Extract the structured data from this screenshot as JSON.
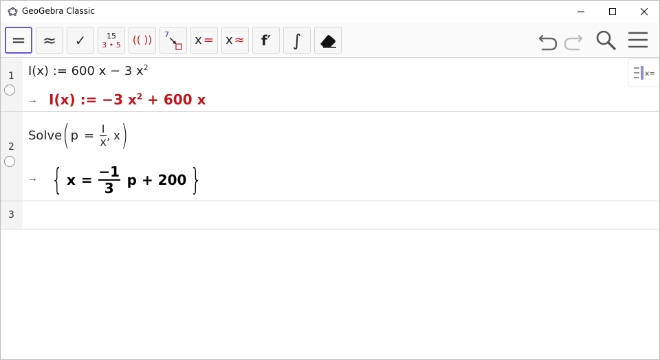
{
  "window": {
    "title": "GeoGebra Classic"
  },
  "toolbar": {
    "buttons": [
      {
        "name": "evaluate",
        "symbol": "="
      },
      {
        "name": "numeric",
        "symbol": "≈"
      },
      {
        "name": "check",
        "symbol": "✓"
      },
      {
        "name": "factor-number",
        "top": "15",
        "bottom": "3 • 5"
      },
      {
        "name": "expand",
        "symbol": "(( ))"
      },
      {
        "name": "substitute",
        "top": "7"
      },
      {
        "name": "solve",
        "symbol": "x",
        "sign": "="
      },
      {
        "name": "solve-numerically",
        "symbol": "x",
        "sign": "≈"
      },
      {
        "name": "derivative",
        "symbol": "f′"
      },
      {
        "name": "integral",
        "symbol": "∫"
      },
      {
        "name": "delete",
        "symbol": ""
      }
    ]
  },
  "algebra": {
    "rows": [
      {
        "number": "1",
        "input": {
          "lhs": "I(x) := 600 x − 3 x",
          "exp": "2"
        },
        "output": {
          "part1": "I(x) := −3 x",
          "exp": "2",
          "part2": " + 600 x"
        }
      },
      {
        "number": "2",
        "input": {
          "func": "Solve",
          "p": "p",
          "eq": "=",
          "num": "I",
          "den": "x",
          "tail": ", x"
        },
        "output": {
          "var": "x",
          "eq": "=",
          "num": "−1",
          "den": "3",
          "tail": "p + 200"
        }
      },
      {
        "number": "3"
      }
    ]
  },
  "colors": {
    "accent": "#6557d2",
    "output_red": "#c0171e",
    "toolbar_icon_gray": "#555555"
  }
}
